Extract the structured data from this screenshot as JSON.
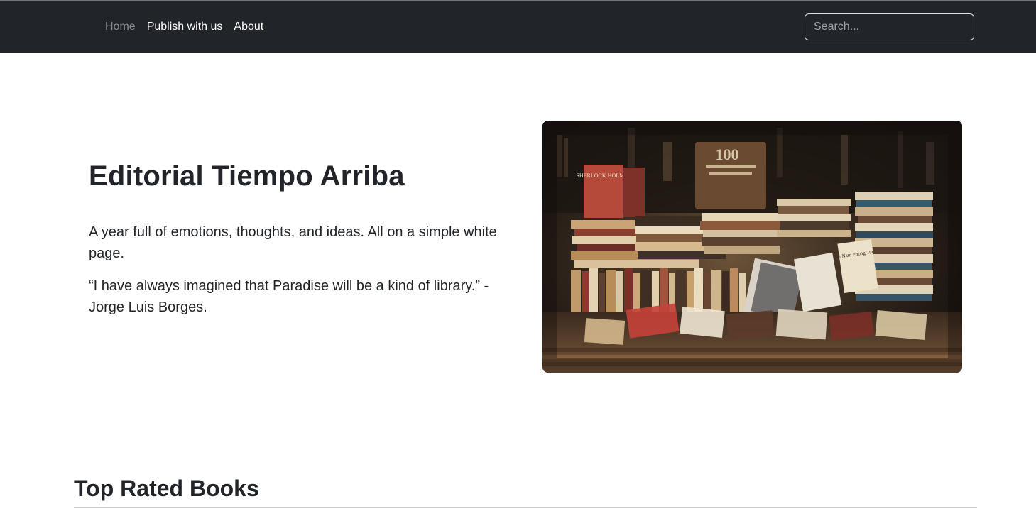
{
  "nav": {
    "items": [
      {
        "label": "Home",
        "active": false
      },
      {
        "label": "Publish with us",
        "active": true
      },
      {
        "label": "About",
        "active": true
      }
    ],
    "search_placeholder": "Search..."
  },
  "hero": {
    "title": "Editorial Tiempo Arriba",
    "lead": "A year full of emotions, thoughts, and ideas. All on a simple white page.",
    "quote": "“I have always imagined that Paradise will be a kind of library.” - Jorge Luis Borges.",
    "image_alt": "Stacks of books in a bookstore",
    "image_labels": {
      "sign": "100",
      "book_spine": "SHERLOCK HOLMES",
      "book_cover": "Viet Nam Phong Tuc"
    }
  },
  "section": {
    "title": "Top Rated Books"
  },
  "colors": {
    "navbar_bg": "#212529",
    "nav_text": "#ffffff",
    "nav_muted": "#8a8d91",
    "body_text": "#212529"
  }
}
